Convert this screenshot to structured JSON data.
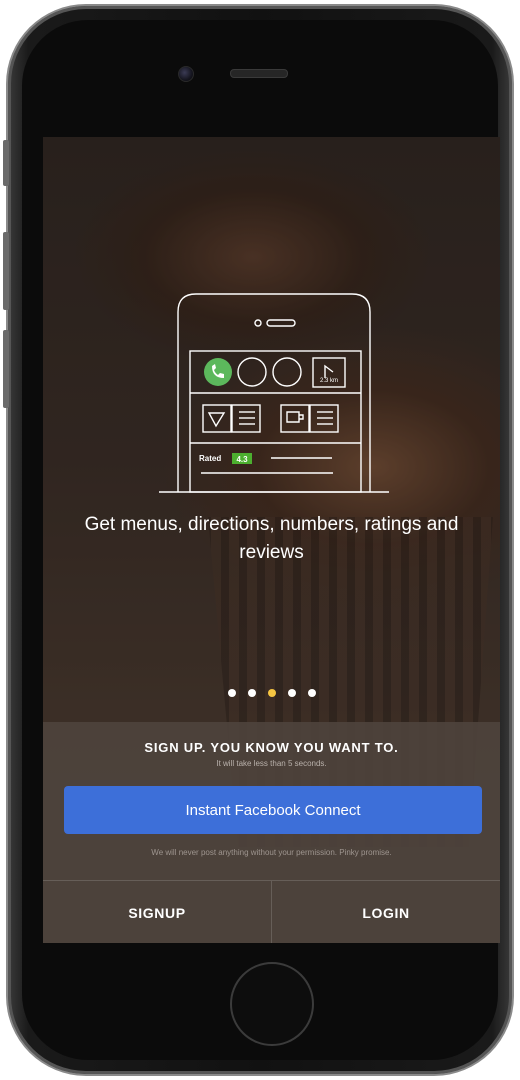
{
  "onboarding": {
    "tagline": "Get menus, directions, numbers, ratings and reviews",
    "pager": {
      "count": 5,
      "active_index": 2
    },
    "illustration": {
      "distance_label": "2.3 km",
      "rated_label": "Rated",
      "rating_value": "4.3"
    }
  },
  "signup": {
    "title": "SIGN UP. YOU KNOW YOU WANT TO.",
    "subtitle": "It will take less than 5 seconds.",
    "facebook_button_label": "Instant Facebook Connect",
    "privacy_note": "We will never post anything without your permission. Pinky promise.",
    "signup_button_label": "SIGNUP",
    "login_button_label": "LOGIN"
  },
  "colors": {
    "facebook_blue": "#3d6fd9",
    "pager_active": "#f5c542",
    "call_green": "#5cb85c",
    "rating_green": "#4caf2f"
  }
}
